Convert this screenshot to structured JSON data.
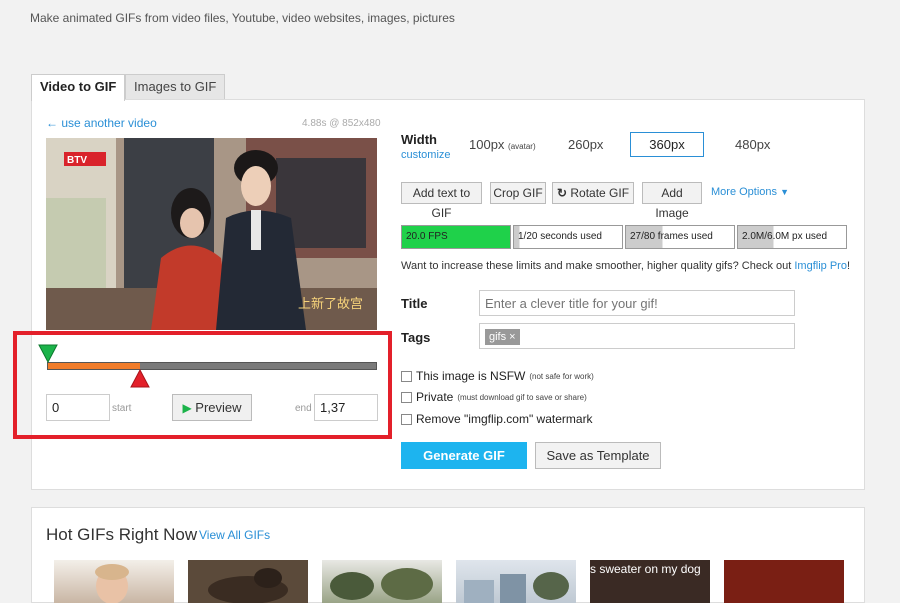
{
  "tagline": "Make animated GIFs from video files, Youtube, video websites, images, pictures",
  "tabs": [
    {
      "label": "Video to GIF",
      "active": true
    },
    {
      "label": "Images to GIF",
      "active": false
    }
  ],
  "video": {
    "back_link": "← use another video",
    "meta": "4.88s @ 852x480",
    "channel_logo": "BTV",
    "caption": "上新了故宫"
  },
  "trim": {
    "start_value": "0",
    "start_label": "start",
    "end_label": "end",
    "end_value": "1,37",
    "preview_label": "Preview",
    "selection_fraction": 0.28
  },
  "width": {
    "label": "Width",
    "customize": "customize",
    "options": [
      "100px",
      "260px",
      "360px",
      "480px"
    ],
    "option_note": "(avatar)",
    "selected": "360px"
  },
  "tools": {
    "add_text": "Add text to GIF",
    "crop": "Crop GIF",
    "rotate": "Rotate GIF",
    "add_image": "Add Image",
    "more": "More Options"
  },
  "limits": {
    "fps": "20.0 FPS",
    "seconds": "1/20 seconds used",
    "frames": "27/80 frames used",
    "pixels": "2.0M/6.0M px used",
    "upsell_text": "Want to increase these limits and make smoother, higher quality gifs? Check out",
    "upsell_link": "Imgflip Pro",
    "upsell_end": "!"
  },
  "form": {
    "title_label": "Title",
    "title_placeholder": "Enter a clever title for your gif!",
    "tags_label": "Tags",
    "tag_chip": "gifs ×"
  },
  "options": {
    "nsfw": "This image is NSFW",
    "nsfw_note": "(not safe for work)",
    "private": "Private",
    "private_note": "(must download gif to save or share)",
    "watermark": "Remove \"imgflip.com\" watermark"
  },
  "actions": {
    "generate": "Generate GIF",
    "template": "Save as Template"
  },
  "hot": {
    "title": "Hot GIFs Right Now",
    "view_all": "View All GIFs",
    "thumb_caption": "s sweater on my dog"
  },
  "colors": {
    "accent": "#1db4ef",
    "link": "#2a8fd6",
    "highlight": "#e3202a",
    "fps_bar": "#1fd14a",
    "trim_fill": "#f07c2a"
  }
}
